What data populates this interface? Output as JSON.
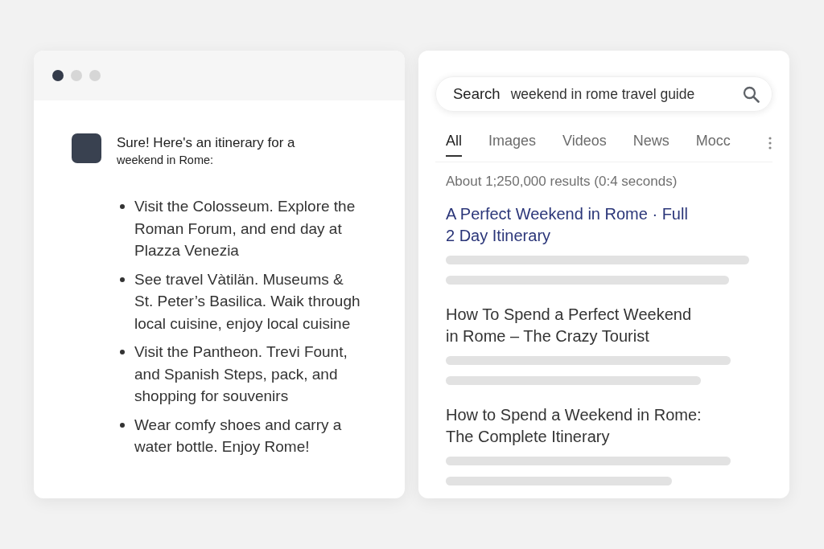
{
  "chat_window": {
    "window_dots": [
      {
        "color": "#343b4a"
      },
      {
        "color": "#d6d6d6"
      },
      {
        "color": "#d6d6d6"
      }
    ],
    "message": {
      "heading": "Sure! Here's an itinerary for a",
      "subheading": "weekend in Rome:",
      "bullets": [
        "Visit the Colosseum. Explore the Roman Forum, and end day at Plazza Venezia",
        "See travel Vàtilän. Museums & St. Peter’s Basilica. Waik through local cuisine, enjoy local cuisine",
        "Visit the Pantheon. Trevi Fount, and Spanish Steps, pack, and shopping for souvenirs",
        "Wear comfy shoes and carry a water bottle. Enjoy Rome!"
      ]
    }
  },
  "search_window": {
    "search": {
      "label": "Search",
      "value": "weekend in rome travel guide"
    },
    "tabs": [
      {
        "label": "All",
        "selected": true
      },
      {
        "label": "Images",
        "selected": false
      },
      {
        "label": "Videos",
        "selected": false
      },
      {
        "label": "News",
        "selected": false
      },
      {
        "label": "Mocc",
        "selected": false
      }
    ],
    "result_stats": "About 1;250,000 results (0:4 seconds)",
    "results": [
      {
        "title": "A Perfect Weekend in Rome · Full 2 Day Itinerary",
        "highlighted": true
      },
      {
        "title": "How To Spend a Perfect Weekend in Rome – The Crazy Tourist",
        "highlighted": false
      },
      {
        "title": "How to Spend a Weekend in Rome: The Complete Itinerary",
        "highlighted": false
      }
    ]
  }
}
